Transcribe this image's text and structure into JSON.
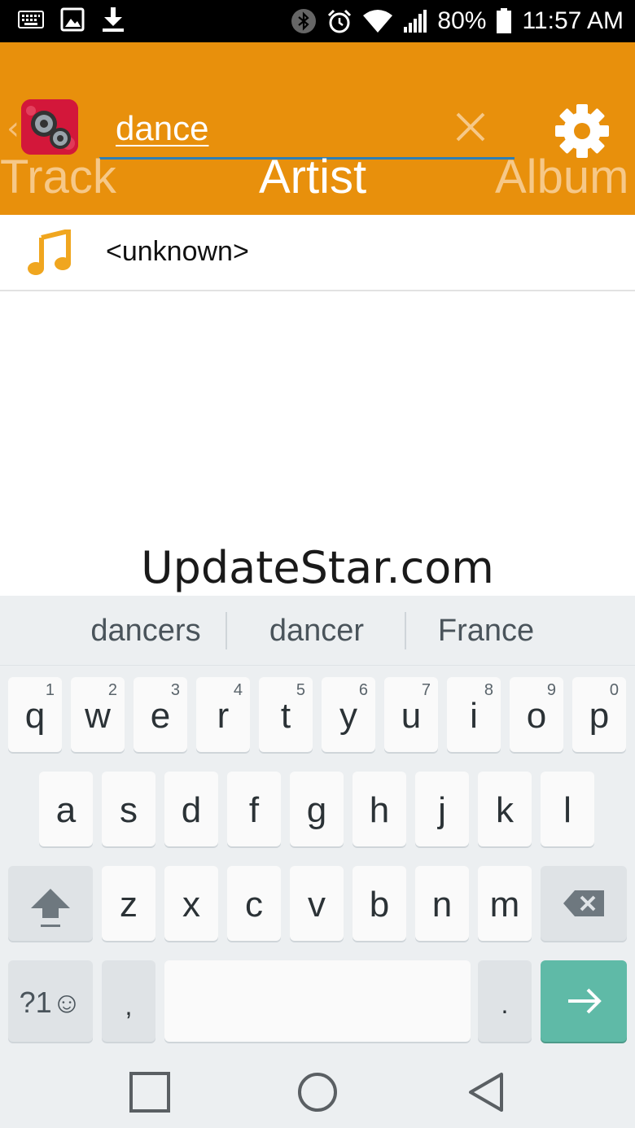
{
  "status_bar": {
    "battery": "80%",
    "time": "11:57 AM",
    "icons": [
      "keyboard-icon",
      "image-icon",
      "download-icon",
      "bluetooth-icon",
      "alarm-icon",
      "wifi-icon",
      "signal-icon",
      "battery-icon"
    ]
  },
  "app_bar": {
    "search": {
      "value": "dance",
      "placeholder": ""
    },
    "tabs": [
      {
        "label": "Track",
        "selected": false
      },
      {
        "label": "Artist",
        "selected": true
      },
      {
        "label": "Album",
        "selected": false
      }
    ],
    "icons": [
      "back-chevron-icon",
      "app-logo-icon",
      "clear-icon",
      "settings-gear-icon"
    ]
  },
  "results": [
    {
      "icon": "music-note-icon",
      "label": "<unknown>"
    }
  ],
  "watermark": "UpdateStar.com",
  "keyboard": {
    "suggestions": [
      "dancers",
      "dancer",
      "France"
    ],
    "row1": [
      {
        "k": "q",
        "h": "1"
      },
      {
        "k": "w",
        "h": "2"
      },
      {
        "k": "e",
        "h": "3"
      },
      {
        "k": "r",
        "h": "4"
      },
      {
        "k": "t",
        "h": "5"
      },
      {
        "k": "y",
        "h": "6"
      },
      {
        "k": "u",
        "h": "7"
      },
      {
        "k": "i",
        "h": "8"
      },
      {
        "k": "o",
        "h": "9"
      },
      {
        "k": "p",
        "h": "0"
      }
    ],
    "row2": [
      "a",
      "s",
      "d",
      "f",
      "g",
      "h",
      "j",
      "k",
      "l"
    ],
    "row3": [
      "z",
      "x",
      "c",
      "v",
      "b",
      "n",
      "m"
    ],
    "symbols_label": "?1",
    "comma": ",",
    "period": ".",
    "colors": {
      "enter": "#5fbaa7",
      "app_bar": "#e8900c"
    }
  },
  "nav_bar": {
    "icons": [
      "recents-square-icon",
      "home-circle-icon",
      "back-triangle-icon"
    ]
  }
}
